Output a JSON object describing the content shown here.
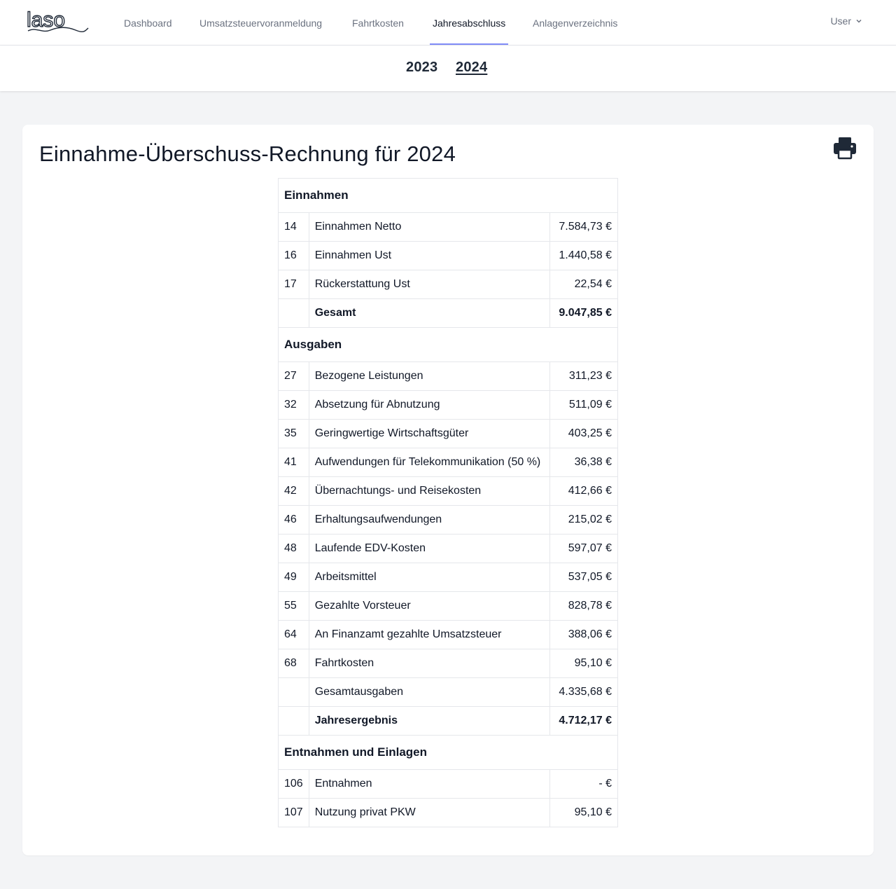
{
  "nav": {
    "logo": "laso",
    "links": [
      "Dashboard",
      "Umsatzsteuervoranmeldung",
      "Fahrtkosten",
      "Jahresabschluss",
      "Anlagenverzeichnis"
    ],
    "active": "Jahresabschluss",
    "user": "User"
  },
  "years": [
    "2023",
    "2024"
  ],
  "active_year": "2024",
  "report": {
    "title": "Einnahme-Überschuss-Rechnung für 2024",
    "print_icon": "print-icon",
    "sections": [
      {
        "heading": "Einnahmen",
        "rows": [
          {
            "num": "14",
            "label": "Einnahmen Netto",
            "amount": "7.584,73 €"
          },
          {
            "num": "16",
            "label": "Einnahmen Ust",
            "amount": "1.440,58 €"
          },
          {
            "num": "17",
            "label": "Rückerstattung Ust",
            "amount": "22,54 €"
          },
          {
            "num": "",
            "label": "Gesamt",
            "amount": "9.047,85 €",
            "bold": true
          }
        ]
      },
      {
        "heading": "Ausgaben",
        "rows": [
          {
            "num": "27",
            "label": "Bezogene Leistungen",
            "amount": "311,23 €"
          },
          {
            "num": "32",
            "label": "Absetzung für Abnutzung",
            "amount": "511,09 €"
          },
          {
            "num": "35",
            "label": "Geringwertige Wirtschaftsgüter",
            "amount": "403,25 €"
          },
          {
            "num": "41",
            "label": "Aufwendungen für Telekommunikation (50 %)",
            "amount": "36,38 €"
          },
          {
            "num": "42",
            "label": "Übernachtungs- und Reisekosten",
            "amount": "412,66 €"
          },
          {
            "num": "46",
            "label": "Erhaltungsaufwendungen",
            "amount": "215,02 €"
          },
          {
            "num": "48",
            "label": "Laufende EDV-Kosten",
            "amount": "597,07 €"
          },
          {
            "num": "49",
            "label": "Arbeitsmittel",
            "amount": "537,05 €"
          },
          {
            "num": "55",
            "label": "Gezahlte Vorsteuer",
            "amount": "828,78 €"
          },
          {
            "num": "64",
            "label": "An Finanzamt gezahlte Umsatzsteuer",
            "amount": "388,06 €"
          },
          {
            "num": "68",
            "label": "Fahrtkosten",
            "amount": "95,10 €"
          },
          {
            "num": "",
            "label": "Gesamtausgaben",
            "amount": "4.335,68 €"
          },
          {
            "num": "",
            "label": "Jahresergebnis",
            "amount": "4.712,17 €",
            "bold": true
          }
        ]
      },
      {
        "heading": "Entnahmen und Einlagen",
        "rows": [
          {
            "num": "106",
            "label": "Entnahmen",
            "amount": "- €"
          },
          {
            "num": "107",
            "label": "Nutzung privat PKW",
            "amount": "95,10 €"
          }
        ]
      }
    ]
  }
}
